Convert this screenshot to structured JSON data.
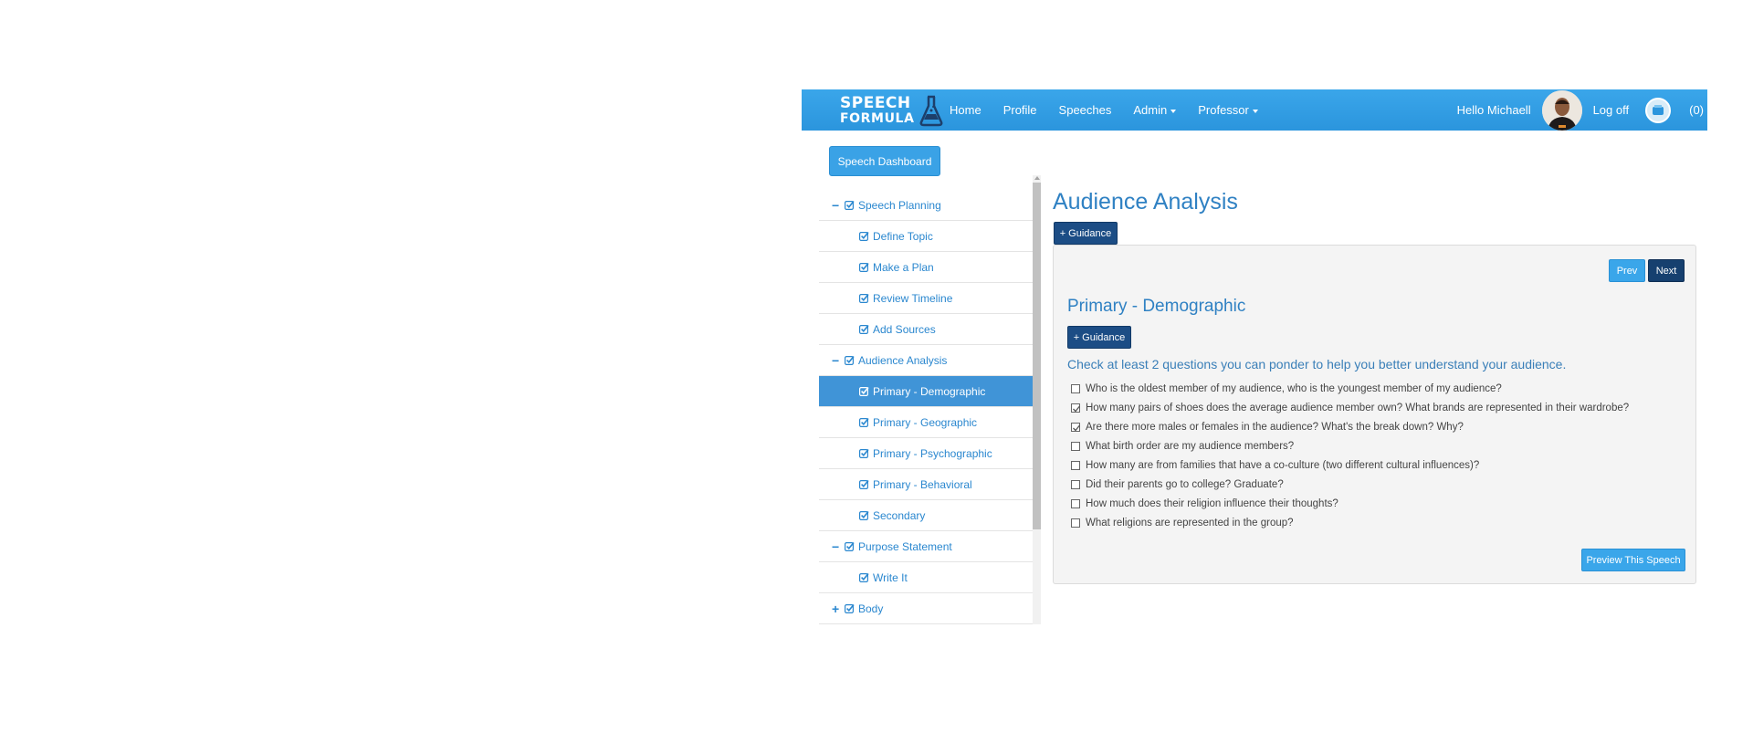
{
  "navbar": {
    "logo_line1": "SPEECH",
    "logo_line2": "FORMULA",
    "links": [
      "Home",
      "Profile",
      "Speeches",
      "Admin",
      "Professor"
    ],
    "greeting": "Hello Michaell",
    "logoff": "Log off",
    "cart_count": "(0)",
    "brand_color": "#2b95dd"
  },
  "dashboard_button": "Speech Dashboard",
  "sidebar": {
    "items": [
      {
        "label": "Speech Planning",
        "level": 1,
        "toggle": "−"
      },
      {
        "label": "Define Topic",
        "level": 2
      },
      {
        "label": "Make a Plan",
        "level": 2
      },
      {
        "label": "Review Timeline",
        "level": 2
      },
      {
        "label": "Add Sources",
        "level": 2
      },
      {
        "label": "Audience Analysis",
        "level": 1,
        "toggle": "−"
      },
      {
        "label": "Primary - Demographic",
        "level": 2,
        "active": true
      },
      {
        "label": "Primary - Geographic",
        "level": 2
      },
      {
        "label": "Primary - Psychographic",
        "level": 2
      },
      {
        "label": "Primary - Behavioral",
        "level": 2
      },
      {
        "label": "Secondary",
        "level": 2
      },
      {
        "label": "Purpose Statement",
        "level": 1,
        "toggle": "−"
      },
      {
        "label": "Write It",
        "level": 2
      },
      {
        "label": "Body",
        "level": 1,
        "toggle": "+"
      }
    ]
  },
  "main": {
    "title": "Audience Analysis",
    "guidance_top": "+ Guidance",
    "prev": "Prev",
    "next": "Next",
    "section_title": "Primary - Demographic",
    "guidance_inner": "+ Guidance",
    "instruction": "Check at least 2 questions you can ponder to help you better understand your audience.",
    "questions": [
      {
        "text": "Who is the oldest member of my audience, who is the youngest member of my audience?",
        "checked": false
      },
      {
        "text": "How many pairs of shoes does the average audience member own? What brands are represented in their wardrobe?",
        "checked": true
      },
      {
        "text": "Are there more males or females in the audience? What's the break down? Why?",
        "checked": true
      },
      {
        "text": "What birth order are my audience members?",
        "checked": false
      },
      {
        "text": "How many are from families that have a co-culture (two different cultural influences)?",
        "checked": false
      },
      {
        "text": "Did their parents go to college? Graduate?",
        "checked": false
      },
      {
        "text": "How much does their religion influence their thoughts?",
        "checked": false
      },
      {
        "text": "What religions are represented in the group?",
        "checked": false
      }
    ],
    "preview_button": "Preview This Speech"
  }
}
